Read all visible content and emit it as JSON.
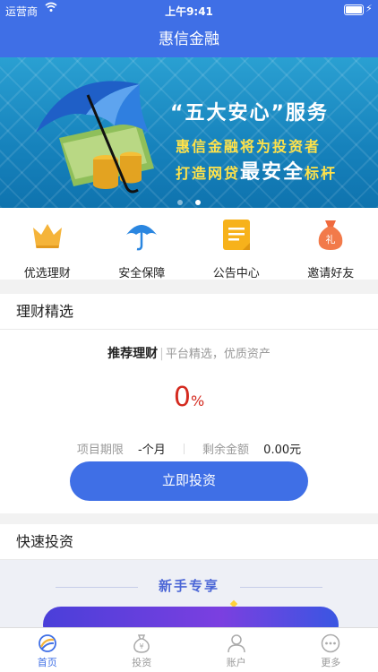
{
  "status_bar": {
    "carrier": "运营商",
    "time": "上午9:41"
  },
  "nav": {
    "title": "惠信金融"
  },
  "banner": {
    "title": "“五大安心”服务",
    "line1": "惠信金融将为投资者",
    "line2_prefix": "打造网贷",
    "line2_highlight": "最安全",
    "line2_suffix": "标杆",
    "dots": 2,
    "active_dot": 2
  },
  "quick_menu": [
    {
      "label": "优选理财",
      "icon": "crown-icon"
    },
    {
      "label": "安全保障",
      "icon": "umbrella-icon"
    },
    {
      "label": "公告中心",
      "icon": "notice-icon"
    },
    {
      "label": "邀请好友",
      "icon": "gift-bag-icon"
    }
  ],
  "finance_section": {
    "title": "理财精选",
    "subtitle_main": "推荐理财",
    "subtitle_sep": "|",
    "subtitle_desc": "平台精选，优质资产",
    "rate_value": "0",
    "rate_unit": "%",
    "term_label": "项目期限",
    "term_value": "-个月",
    "remaining_label": "剩余金额",
    "remaining_value": "0.00元",
    "button_label": "立即投资"
  },
  "quick_invest": {
    "title": "快速投资",
    "banner_title": "新手专享"
  },
  "tab_bar": [
    {
      "label": "首页",
      "icon": "home-icon",
      "active": true
    },
    {
      "label": "投资",
      "icon": "invest-bag-icon",
      "active": false
    },
    {
      "label": "账户",
      "icon": "account-icon",
      "active": false
    },
    {
      "label": "更多",
      "icon": "more-icon",
      "active": false
    }
  ],
  "colors": {
    "primary": "#3f6fe6",
    "rate_red": "#d42a1f",
    "banner_yellow": "#ffe24a"
  }
}
